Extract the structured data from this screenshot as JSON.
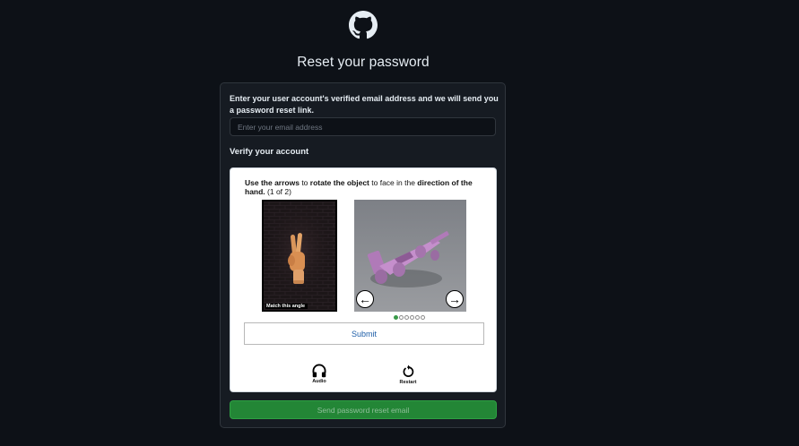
{
  "header": {
    "logo_icon": "github-mark-icon",
    "title": "Reset your password"
  },
  "form": {
    "instructions": "Enter your user account's verified email address and we will send you a password reset link.",
    "email_placeholder": "Enter your email address",
    "email_value": "",
    "verify_heading": "Verify your account",
    "send_button_label": "Send password reset email"
  },
  "captcha": {
    "instruction_parts": [
      {
        "text": "Use the arrows",
        "bold": true
      },
      {
        "text": " to ",
        "bold": false
      },
      {
        "text": "rotate the object",
        "bold": true
      },
      {
        "text": " to face in the ",
        "bold": false
      },
      {
        "text": "direction of the hand.",
        "bold": true
      },
      {
        "text": " (1 of 2)",
        "bold": false
      }
    ],
    "reference_label": "Match this angle",
    "left_arrow": "←",
    "right_arrow": "→",
    "progress": {
      "current": 1,
      "total": 6
    },
    "submit_label": "Submit",
    "audio_label": "Audio",
    "restart_label": "Restart",
    "audio_icon": "headphones-icon",
    "restart_icon": "restart-icon"
  },
  "colors": {
    "page_bg": "#0d1117",
    "card_bg": "#161b22",
    "border": "#30363d",
    "text": "#e6edf3",
    "send_button": "#238636",
    "submit_text": "#1f5fa8",
    "active_dot": "#3a9a4a"
  }
}
